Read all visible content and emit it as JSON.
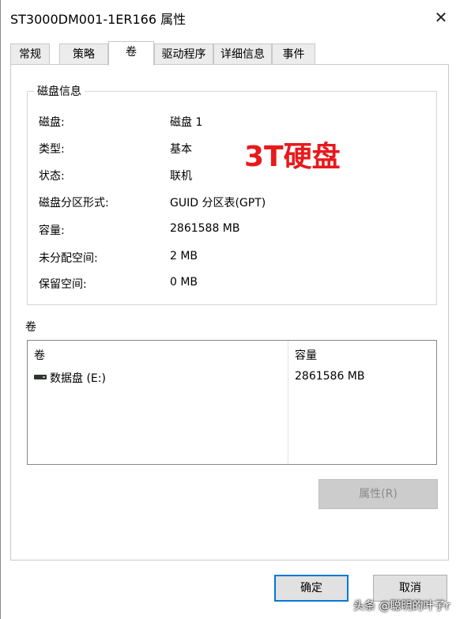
{
  "window": {
    "title": "ST3000DM001-1ER166 属性",
    "close_glyph": "✕"
  },
  "tabs": [
    {
      "label": "常规"
    },
    {
      "label": "策略"
    },
    {
      "label": "卷"
    },
    {
      "label": "驱动程序"
    },
    {
      "label": "详细信息"
    },
    {
      "label": "事件"
    }
  ],
  "active_tab": "卷",
  "disk_info": {
    "group_title": "磁盘信息",
    "rows": [
      {
        "label": "磁盘:",
        "value": "磁盘 1"
      },
      {
        "label": "类型:",
        "value": "基本"
      },
      {
        "label": "状态:",
        "value": "联机"
      },
      {
        "label": "磁盘分区形式:",
        "value": "GUID 分区表(GPT)"
      },
      {
        "label": "容量:",
        "value": "2861588 MB"
      },
      {
        "label": "未分配空间:",
        "value": "2 MB"
      },
      {
        "label": "保留空间:",
        "value": "0 MB"
      }
    ]
  },
  "annotation": {
    "text": "3T硬盘",
    "color": "#e8191c"
  },
  "volumes": {
    "section_label": "卷",
    "columns": [
      "卷",
      "容量"
    ],
    "rows": [
      {
        "name": "数据盘 (E:)",
        "capacity": "2861586 MB",
        "icon": "drive-icon"
      }
    ]
  },
  "properties_button": {
    "label": "属性(R)",
    "enabled": false
  },
  "footer": {
    "ok_label": "确定",
    "cancel_label": "取消"
  },
  "watermark": "头条 @聪明的叶子r",
  "colors": {
    "accent": "#0078d7",
    "annotation": "#e8191c"
  }
}
